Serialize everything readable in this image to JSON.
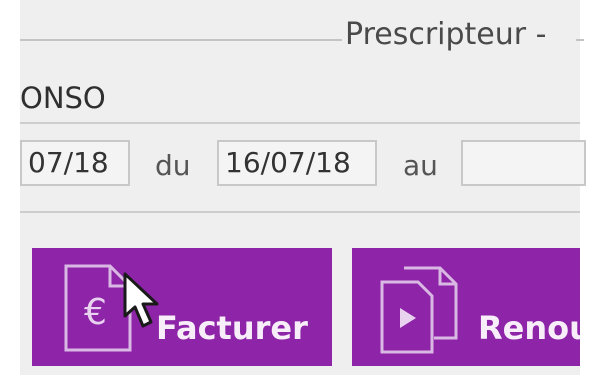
{
  "fieldset": {
    "legend": "Prescripteur -"
  },
  "patient": {
    "name_fragment": "ONSO"
  },
  "period": {
    "start_partial": "07/18",
    "from_label": "du",
    "from_value": "16/07/18",
    "to_label": "au",
    "to_value": ""
  },
  "actions": {
    "invoice_label": "Facturer",
    "renew_label": "Renou"
  },
  "colors": {
    "button_bg": "#8e24a8",
    "panel_bg": "#efefef"
  },
  "icons": {
    "invoice": "euro-document-icon",
    "renew": "copy-documents-icon",
    "pointer": "mouse-pointer-icon"
  }
}
